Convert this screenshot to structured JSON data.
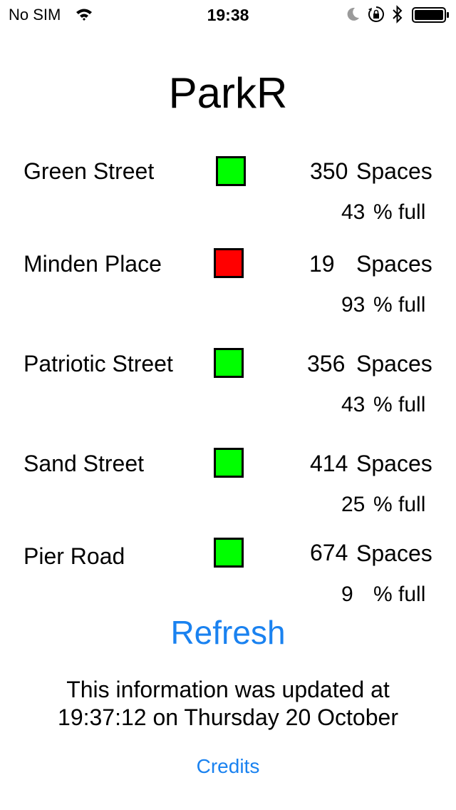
{
  "status_bar": {
    "carrier": "No SIM",
    "time": "19:38",
    "icons": [
      "wifi-icon",
      "moon-icon",
      "rotation-lock-icon",
      "bluetooth-icon",
      "battery-icon"
    ]
  },
  "app": {
    "title": "ParkR"
  },
  "car_parks": [
    {
      "name": "Green Street",
      "spaces": "350",
      "spaces_label": "Spaces",
      "percent": "43",
      "percent_label": "% full",
      "status_color": "#00ff00"
    },
    {
      "name": "Minden Place",
      "spaces": "19",
      "spaces_label": "Spaces",
      "percent": "93",
      "percent_label": "% full",
      "status_color": "#ff0000"
    },
    {
      "name": "Patriotic Street",
      "spaces": "356",
      "spaces_label": "Spaces",
      "percent": "43",
      "percent_label": "% full",
      "status_color": "#00ff00"
    },
    {
      "name": "Sand Street",
      "spaces": "414",
      "spaces_label": "Spaces",
      "percent": "25",
      "percent_label": "% full",
      "status_color": "#00ff00"
    },
    {
      "name": "Pier Road",
      "spaces": "674",
      "spaces_label": "Spaces",
      "percent": "9",
      "percent_label": "% full",
      "status_color": "#00ff00"
    }
  ],
  "actions": {
    "refresh_label": "Refresh",
    "credits_label": "Credits"
  },
  "footer": {
    "update_line_1": "This information was updated at",
    "update_line_2": "19:37:12 on Thursday 20 October"
  },
  "colors": {
    "accent": "#1a82f0",
    "available": "#00ff00",
    "full": "#ff0000"
  }
}
